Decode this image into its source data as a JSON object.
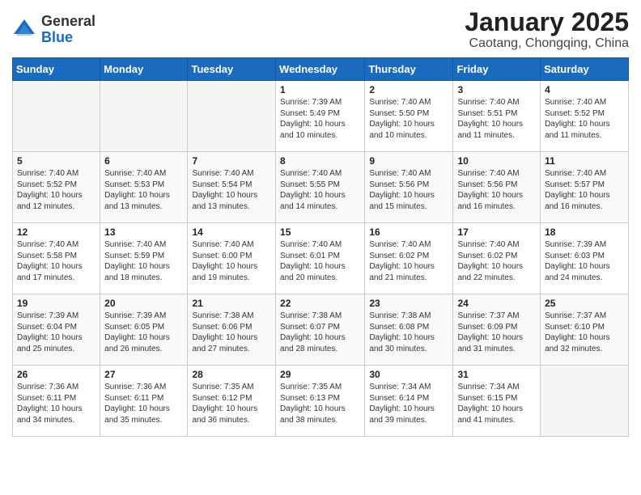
{
  "header": {
    "logo_general": "General",
    "logo_blue": "Blue",
    "title": "January 2025",
    "subtitle": "Caotang, Chongqing, China"
  },
  "days_of_week": [
    "Sunday",
    "Monday",
    "Tuesday",
    "Wednesday",
    "Thursday",
    "Friday",
    "Saturday"
  ],
  "weeks": [
    [
      {
        "num": "",
        "info": ""
      },
      {
        "num": "",
        "info": ""
      },
      {
        "num": "",
        "info": ""
      },
      {
        "num": "1",
        "info": "Sunrise: 7:39 AM\nSunset: 5:49 PM\nDaylight: 10 hours\nand 10 minutes."
      },
      {
        "num": "2",
        "info": "Sunrise: 7:40 AM\nSunset: 5:50 PM\nDaylight: 10 hours\nand 10 minutes."
      },
      {
        "num": "3",
        "info": "Sunrise: 7:40 AM\nSunset: 5:51 PM\nDaylight: 10 hours\nand 11 minutes."
      },
      {
        "num": "4",
        "info": "Sunrise: 7:40 AM\nSunset: 5:52 PM\nDaylight: 10 hours\nand 11 minutes."
      }
    ],
    [
      {
        "num": "5",
        "info": "Sunrise: 7:40 AM\nSunset: 5:52 PM\nDaylight: 10 hours\nand 12 minutes."
      },
      {
        "num": "6",
        "info": "Sunrise: 7:40 AM\nSunset: 5:53 PM\nDaylight: 10 hours\nand 13 minutes."
      },
      {
        "num": "7",
        "info": "Sunrise: 7:40 AM\nSunset: 5:54 PM\nDaylight: 10 hours\nand 13 minutes."
      },
      {
        "num": "8",
        "info": "Sunrise: 7:40 AM\nSunset: 5:55 PM\nDaylight: 10 hours\nand 14 minutes."
      },
      {
        "num": "9",
        "info": "Sunrise: 7:40 AM\nSunset: 5:56 PM\nDaylight: 10 hours\nand 15 minutes."
      },
      {
        "num": "10",
        "info": "Sunrise: 7:40 AM\nSunset: 5:56 PM\nDaylight: 10 hours\nand 16 minutes."
      },
      {
        "num": "11",
        "info": "Sunrise: 7:40 AM\nSunset: 5:57 PM\nDaylight: 10 hours\nand 16 minutes."
      }
    ],
    [
      {
        "num": "12",
        "info": "Sunrise: 7:40 AM\nSunset: 5:58 PM\nDaylight: 10 hours\nand 17 minutes."
      },
      {
        "num": "13",
        "info": "Sunrise: 7:40 AM\nSunset: 5:59 PM\nDaylight: 10 hours\nand 18 minutes."
      },
      {
        "num": "14",
        "info": "Sunrise: 7:40 AM\nSunset: 6:00 PM\nDaylight: 10 hours\nand 19 minutes."
      },
      {
        "num": "15",
        "info": "Sunrise: 7:40 AM\nSunset: 6:01 PM\nDaylight: 10 hours\nand 20 minutes."
      },
      {
        "num": "16",
        "info": "Sunrise: 7:40 AM\nSunset: 6:02 PM\nDaylight: 10 hours\nand 21 minutes."
      },
      {
        "num": "17",
        "info": "Sunrise: 7:40 AM\nSunset: 6:02 PM\nDaylight: 10 hours\nand 22 minutes."
      },
      {
        "num": "18",
        "info": "Sunrise: 7:39 AM\nSunset: 6:03 PM\nDaylight: 10 hours\nand 24 minutes."
      }
    ],
    [
      {
        "num": "19",
        "info": "Sunrise: 7:39 AM\nSunset: 6:04 PM\nDaylight: 10 hours\nand 25 minutes."
      },
      {
        "num": "20",
        "info": "Sunrise: 7:39 AM\nSunset: 6:05 PM\nDaylight: 10 hours\nand 26 minutes."
      },
      {
        "num": "21",
        "info": "Sunrise: 7:38 AM\nSunset: 6:06 PM\nDaylight: 10 hours\nand 27 minutes."
      },
      {
        "num": "22",
        "info": "Sunrise: 7:38 AM\nSunset: 6:07 PM\nDaylight: 10 hours\nand 28 minutes."
      },
      {
        "num": "23",
        "info": "Sunrise: 7:38 AM\nSunset: 6:08 PM\nDaylight: 10 hours\nand 30 minutes."
      },
      {
        "num": "24",
        "info": "Sunrise: 7:37 AM\nSunset: 6:09 PM\nDaylight: 10 hours\nand 31 minutes."
      },
      {
        "num": "25",
        "info": "Sunrise: 7:37 AM\nSunset: 6:10 PM\nDaylight: 10 hours\nand 32 minutes."
      }
    ],
    [
      {
        "num": "26",
        "info": "Sunrise: 7:36 AM\nSunset: 6:11 PM\nDaylight: 10 hours\nand 34 minutes."
      },
      {
        "num": "27",
        "info": "Sunrise: 7:36 AM\nSunset: 6:11 PM\nDaylight: 10 hours\nand 35 minutes."
      },
      {
        "num": "28",
        "info": "Sunrise: 7:35 AM\nSunset: 6:12 PM\nDaylight: 10 hours\nand 36 minutes."
      },
      {
        "num": "29",
        "info": "Sunrise: 7:35 AM\nSunset: 6:13 PM\nDaylight: 10 hours\nand 38 minutes."
      },
      {
        "num": "30",
        "info": "Sunrise: 7:34 AM\nSunset: 6:14 PM\nDaylight: 10 hours\nand 39 minutes."
      },
      {
        "num": "31",
        "info": "Sunrise: 7:34 AM\nSunset: 6:15 PM\nDaylight: 10 hours\nand 41 minutes."
      },
      {
        "num": "",
        "info": ""
      }
    ]
  ]
}
